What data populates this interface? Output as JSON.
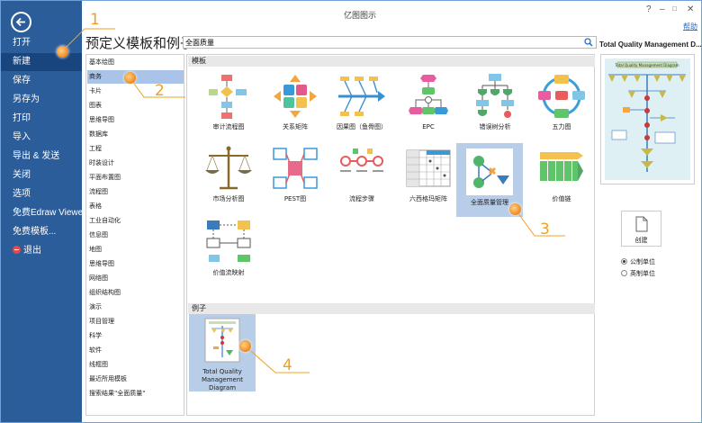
{
  "window": {
    "title": "亿图图示",
    "help_label": "帮助",
    "controls": [
      "?",
      "–",
      "□",
      "✕"
    ]
  },
  "sidebar": {
    "items": [
      {
        "label": "打开"
      },
      {
        "label": "新建",
        "active": true
      },
      {
        "label": "保存"
      },
      {
        "label": "另存为"
      },
      {
        "label": "打印"
      },
      {
        "label": "导入"
      },
      {
        "label": "导出 & 发送"
      },
      {
        "label": "关闭"
      },
      {
        "label": "选项"
      },
      {
        "label": "免费Edraw Viewer"
      },
      {
        "label": "免费模板..."
      },
      {
        "label": "退出"
      }
    ]
  },
  "main": {
    "heading": "预定义模板和例子",
    "search": {
      "value": "全面质量",
      "placeholder": ""
    }
  },
  "categories": [
    {
      "label": "基本绘图"
    },
    {
      "label": "商务",
      "selected": true
    },
    {
      "label": "卡片"
    },
    {
      "label": "图表"
    },
    {
      "label": "思维导图"
    },
    {
      "label": "数据库"
    },
    {
      "label": "工程"
    },
    {
      "label": "时装设计"
    },
    {
      "label": "平面布置图"
    },
    {
      "label": "流程图"
    },
    {
      "label": "表格"
    },
    {
      "label": "工业自动化"
    },
    {
      "label": "信息图"
    },
    {
      "label": "地图"
    },
    {
      "label": "思维导图"
    },
    {
      "label": "网络图"
    },
    {
      "label": "组织结构图"
    },
    {
      "label": "演示"
    },
    {
      "label": "项目管理"
    },
    {
      "label": "科学"
    },
    {
      "label": "软件"
    },
    {
      "label": "线框图"
    },
    {
      "label": "最近所用模板"
    },
    {
      "label": "搜索结果\"全面质量\""
    }
  ],
  "templates_section": {
    "header": "模板",
    "tiles": [
      {
        "label": "审计流程图",
        "icon": "audit-flowchart-icon"
      },
      {
        "label": "关系矩阵",
        "icon": "relation-matrix-icon"
      },
      {
        "label": "因果图（鱼骨图）",
        "icon": "fishbone-icon"
      },
      {
        "label": "EPC",
        "icon": "epc-icon"
      },
      {
        "label": "错误树分析",
        "icon": "fault-tree-icon"
      },
      {
        "label": "五力图",
        "icon": "five-forces-icon"
      },
      {
        "label": "市场分析图",
        "icon": "scale-icon"
      },
      {
        "label": "PEST图",
        "icon": "pest-icon"
      },
      {
        "label": "流程步骤",
        "icon": "process-steps-icon"
      },
      {
        "label": "六西格玛矩阵",
        "icon": "six-sigma-icon"
      },
      {
        "label": "全面质量管理",
        "icon": "tqm-icon",
        "selected": true
      },
      {
        "label": "价值链",
        "icon": "value-chain-icon"
      },
      {
        "label": "价值流映射",
        "icon": "value-stream-icon"
      }
    ]
  },
  "examples_section": {
    "header": "例子",
    "tiles": [
      {
        "label": "Total Quality Management Diagram",
        "icon": "tqm-example-thumbnail",
        "selected": true
      }
    ]
  },
  "preview": {
    "title": "Total Quality Management D...",
    "thumbnail_title": "Total Quality Management Diagram",
    "create_label": "创建",
    "units": [
      {
        "label": "公制单位",
        "selected": true
      },
      {
        "label": "英制单位",
        "selected": false
      }
    ]
  },
  "callouts": [
    "1",
    "2",
    "3",
    "4"
  ],
  "colors": {
    "sidebar_bg": "#2b5d9b",
    "sidebar_active": "#19457e",
    "category_selected": "#a9c4e8",
    "tile_selected": "#b8cde8",
    "callout": "#f0a020"
  }
}
